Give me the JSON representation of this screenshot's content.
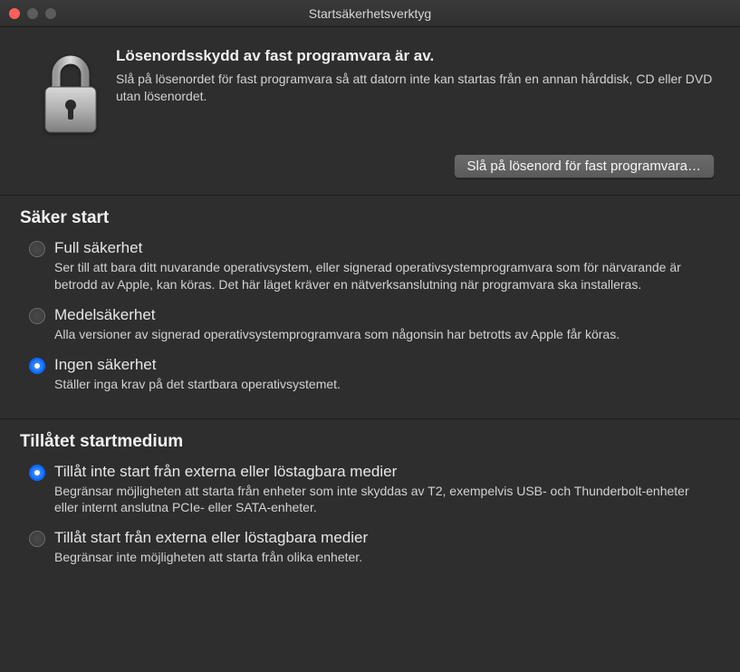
{
  "titlebar": {
    "title": "Startsäkerhetsverktyg"
  },
  "firmware": {
    "heading": "Lösenordsskydd av fast programvara är av.",
    "description": "Slå på lösenordet för fast programvara så att datorn inte kan startas från en annan hårddisk, CD eller DVD utan lösenordet.",
    "button": "Slå på lösenord för fast programvara…"
  },
  "secure_boot": {
    "heading": "Säker start",
    "options": [
      {
        "label": "Full säkerhet",
        "desc": "Ser till att bara ditt nuvarande operativsystem, eller signerad operativsystemprogramvara som för närvarande är betrodd av Apple, kan köras. Det här läget kräver en nätverksanslutning när programvara ska installeras.",
        "selected": false
      },
      {
        "label": "Medelsäkerhet",
        "desc": "Alla versioner av signerad operativsystemprogramvara som någonsin har betrotts av Apple får köras.",
        "selected": false
      },
      {
        "label": "Ingen säkerhet",
        "desc": "Ställer inga krav på det startbara operativsystemet.",
        "selected": true
      }
    ]
  },
  "allowed_boot_media": {
    "heading": "Tillåtet startmedium",
    "options": [
      {
        "label": "Tillåt inte start från externa eller löstagbara medier",
        "desc": "Begränsar möjligheten att starta från enheter som inte skyddas av T2, exempelvis USB- och Thunderbolt-enheter eller internt anslutna PCIe- eller SATA-enheter.",
        "selected": true
      },
      {
        "label": "Tillåt start från externa eller löstagbara medier",
        "desc": "Begränsar inte möjligheten att starta från olika enheter.",
        "selected": false
      }
    ]
  }
}
